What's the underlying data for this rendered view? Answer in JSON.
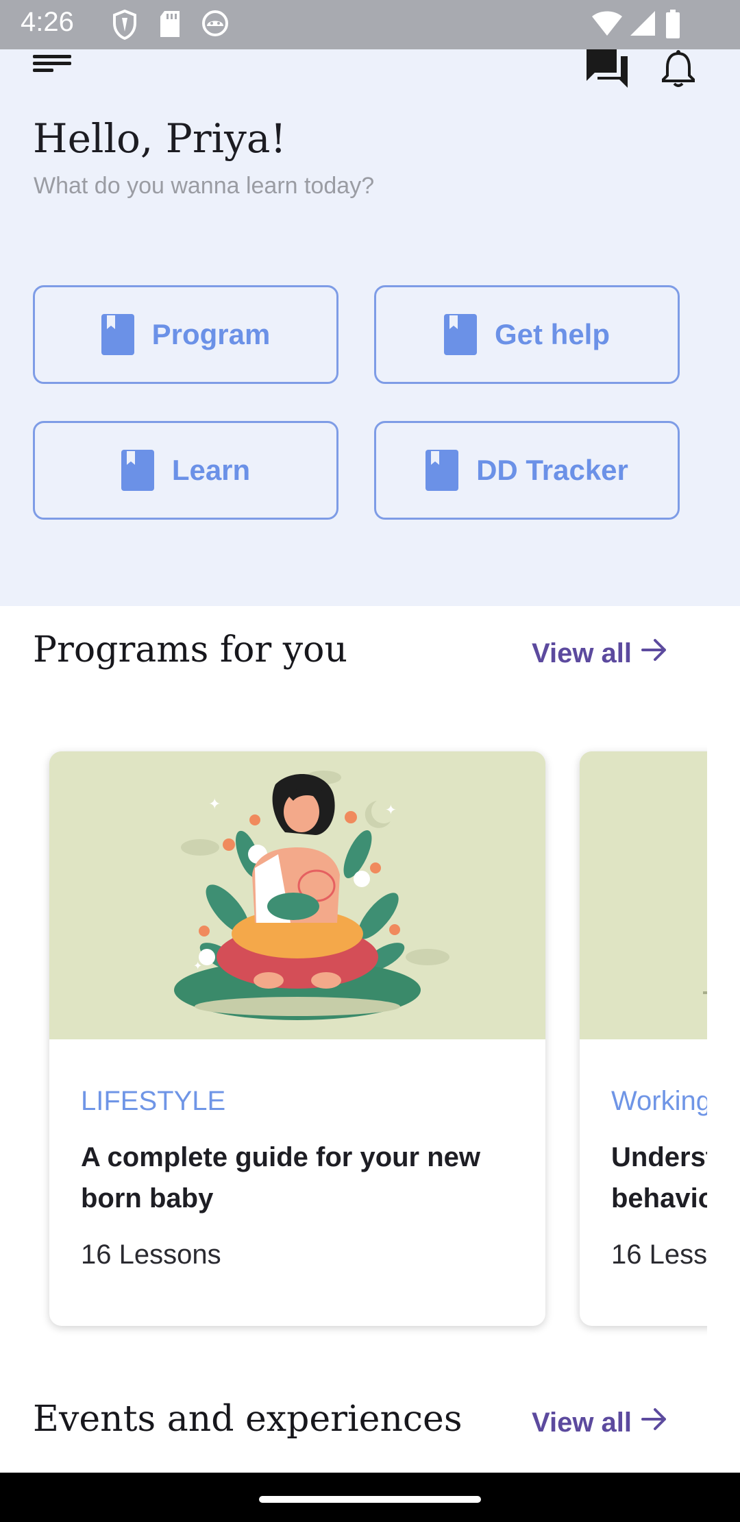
{
  "status_bar": {
    "time": "4:26",
    "left_icons": [
      "shield-icon",
      "sd-card-icon",
      "android-head-icon"
    ],
    "right_icons": [
      "wifi-icon",
      "cell-signal-icon",
      "battery-icon"
    ]
  },
  "header": {
    "greeting": "Hello, Priya!",
    "subtitle": "What do you wanna learn today?",
    "icons": [
      "menu-icon",
      "chat-icon",
      "bell-icon"
    ]
  },
  "quick_actions": [
    {
      "label": "Program",
      "icon": "bookmark-book-icon"
    },
    {
      "label": "Get help",
      "icon": "bookmark-book-icon"
    },
    {
      "label": "Learn",
      "icon": "bookmark-book-icon"
    },
    {
      "label": "DD Tracker",
      "icon": "bookmark-book-icon"
    }
  ],
  "programs": {
    "title": "Programs for you",
    "view_all": "View all",
    "cards": [
      {
        "category": "LIFESTYLE",
        "title": "A complete guide for your new born baby",
        "lessons": "16 Lessons",
        "image": "mother-breastfeeding-illustration"
      },
      {
        "category": "Working",
        "title": "Underst behavio",
        "lessons": "16 Less",
        "image": "illustration"
      }
    ]
  },
  "events": {
    "title": "Events and experiences",
    "view_all": "View all"
  },
  "colors": {
    "hero_bg": "#edf1fb",
    "accent_blue": "#6b91e7",
    "view_all_purple": "#5c4a9e",
    "card_image_bg": "#dfe4c3"
  }
}
